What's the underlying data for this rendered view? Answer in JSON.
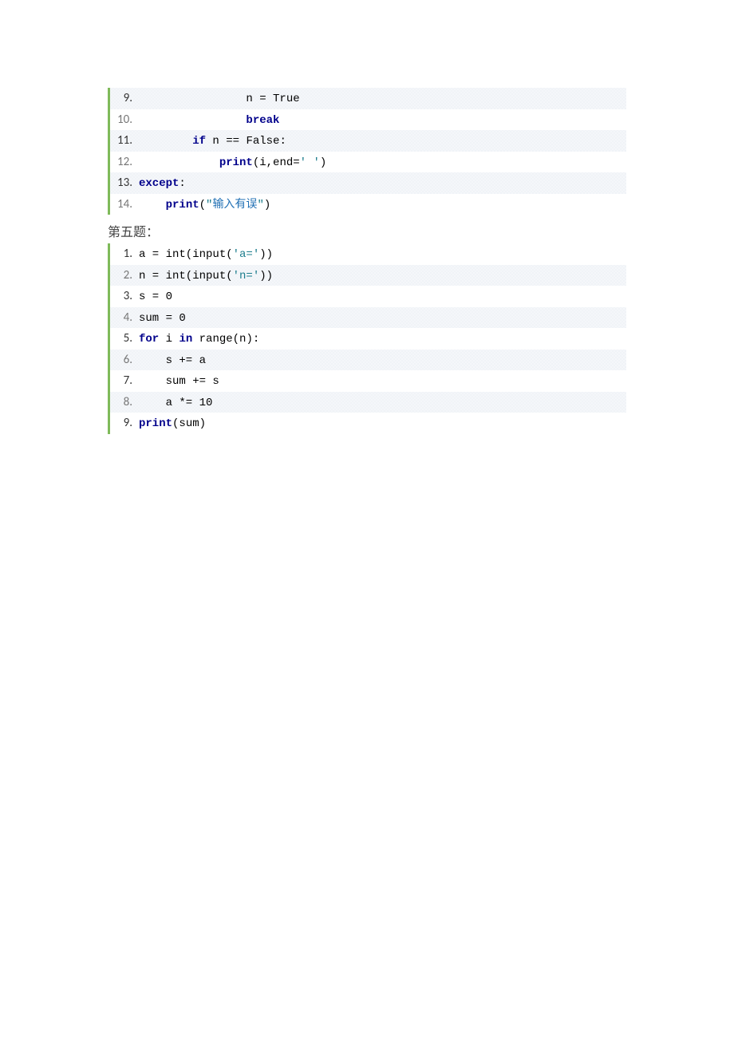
{
  "block1": {
    "lines": [
      {
        "num": "9.",
        "tokens": [
          {
            "cls": "norm",
            "txt": "                n = True"
          }
        ]
      },
      {
        "num": "10.",
        "tokens": [
          {
            "cls": "norm",
            "txt": "                "
          },
          {
            "cls": "kw-strong",
            "txt": "break"
          }
        ]
      },
      {
        "num": "11.",
        "tokens": [
          {
            "cls": "norm",
            "txt": "        "
          },
          {
            "cls": "kw-strong",
            "txt": "if"
          },
          {
            "cls": "norm",
            "txt": " n == False:"
          }
        ]
      },
      {
        "num": "12.",
        "tokens": [
          {
            "cls": "norm",
            "txt": "            "
          },
          {
            "cls": "kw-strong",
            "txt": "print"
          },
          {
            "cls": "norm",
            "txt": "(i,end="
          },
          {
            "cls": "str",
            "txt": "' '"
          },
          {
            "cls": "norm",
            "txt": ")"
          }
        ]
      },
      {
        "num": "13.",
        "tokens": [
          {
            "cls": "kw-strong",
            "txt": "except"
          },
          {
            "cls": "norm",
            "txt": ":"
          }
        ]
      },
      {
        "num": "14.",
        "tokens": [
          {
            "cls": "norm",
            "txt": "    "
          },
          {
            "cls": "kw-strong",
            "txt": "print"
          },
          {
            "cls": "norm",
            "txt": "("
          },
          {
            "cls": "str",
            "txt": "\""
          },
          {
            "cls": "cn",
            "txt": "输入有误"
          },
          {
            "cls": "str",
            "txt": "\""
          },
          {
            "cls": "norm",
            "txt": ")"
          }
        ]
      }
    ]
  },
  "heading_text": "第五题：",
  "block2": {
    "lines": [
      {
        "num": "1.",
        "tokens": [
          {
            "cls": "norm",
            "txt": "a = int(input("
          },
          {
            "cls": "str",
            "txt": "'a='"
          },
          {
            "cls": "norm",
            "txt": "))"
          }
        ]
      },
      {
        "num": "2.",
        "tokens": [
          {
            "cls": "norm",
            "txt": "n = int(input("
          },
          {
            "cls": "str",
            "txt": "'n='"
          },
          {
            "cls": "norm",
            "txt": "))"
          }
        ]
      },
      {
        "num": "3.",
        "tokens": [
          {
            "cls": "norm",
            "txt": "s = 0"
          }
        ]
      },
      {
        "num": "4.",
        "tokens": [
          {
            "cls": "norm",
            "txt": "sum = 0"
          }
        ]
      },
      {
        "num": "5.",
        "tokens": [
          {
            "cls": "kw-strong",
            "txt": "for"
          },
          {
            "cls": "norm",
            "txt": " i "
          },
          {
            "cls": "kw-strong",
            "txt": "in"
          },
          {
            "cls": "norm",
            "txt": " range(n):"
          }
        ]
      },
      {
        "num": "6.",
        "tokens": [
          {
            "cls": "norm",
            "txt": "    s += a"
          }
        ]
      },
      {
        "num": "7.",
        "tokens": [
          {
            "cls": "norm",
            "txt": "    sum += s"
          }
        ]
      },
      {
        "num": "8.",
        "tokens": [
          {
            "cls": "norm",
            "txt": "    a *= 10"
          }
        ]
      },
      {
        "num": "9.",
        "tokens": [
          {
            "cls": "kw-strong",
            "txt": "print"
          },
          {
            "cls": "norm",
            "txt": "(sum)"
          }
        ]
      }
    ]
  }
}
